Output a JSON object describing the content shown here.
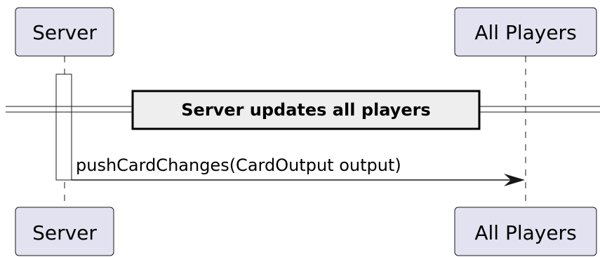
{
  "participants": {
    "server": "Server",
    "all_players": "All Players"
  },
  "divider": {
    "label": "Server updates all players"
  },
  "message": {
    "label": "pushCardChanges(CardOutput output)"
  },
  "colors": {
    "participant_fill": "#e2e2f0",
    "divider_fill": "#eeeeee",
    "line": "#181818"
  }
}
